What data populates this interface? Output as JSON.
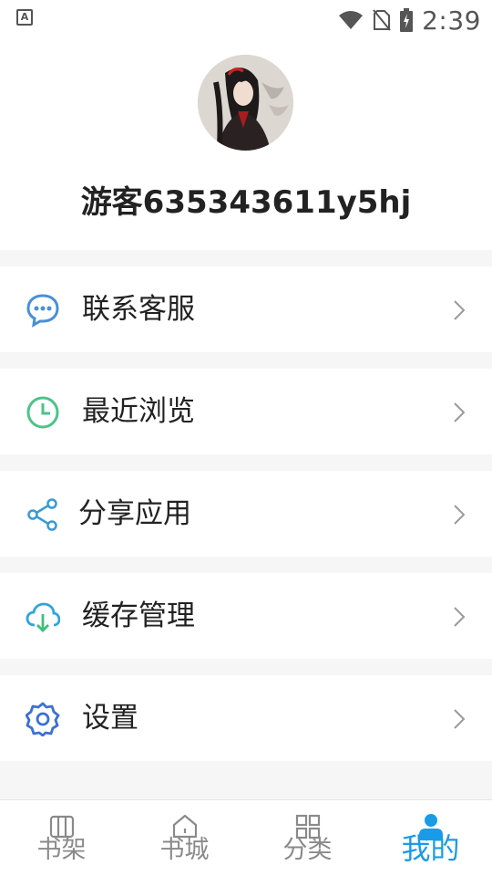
{
  "status_bar": {
    "left_icon": "keyboard-a-icon",
    "time": "2:39",
    "icons": [
      "wifi-icon",
      "no-sim-icon",
      "battery-charging-icon"
    ]
  },
  "profile": {
    "avatar": "avatar-image",
    "username": "游客635343611y5hj"
  },
  "menu": {
    "items": [
      {
        "label": "联系客服",
        "icon": "chat-bubble-icon",
        "color": "#4a8fd8"
      },
      {
        "label": "最近浏览",
        "icon": "clock-icon",
        "color": "#4cc38a"
      },
      {
        "label": "分享应用",
        "icon": "share-icon",
        "color": "#3a9ad6"
      },
      {
        "label": "缓存管理",
        "icon": "cloud-download-icon",
        "color": "#2ea6dc"
      },
      {
        "label": "设置",
        "icon": "gear-icon",
        "color": "#3d6fd8"
      }
    ]
  },
  "bottom_nav": {
    "items": [
      {
        "label": "书架",
        "icon": "bookshelf-icon"
      },
      {
        "label": "书城",
        "icon": "home-icon"
      },
      {
        "label": "分类",
        "icon": "grid-icon"
      },
      {
        "label": "我的",
        "icon": "person-icon",
        "active": true
      }
    ],
    "active_color": "#1a9be8",
    "inactive_color": "#8a8a8a"
  }
}
